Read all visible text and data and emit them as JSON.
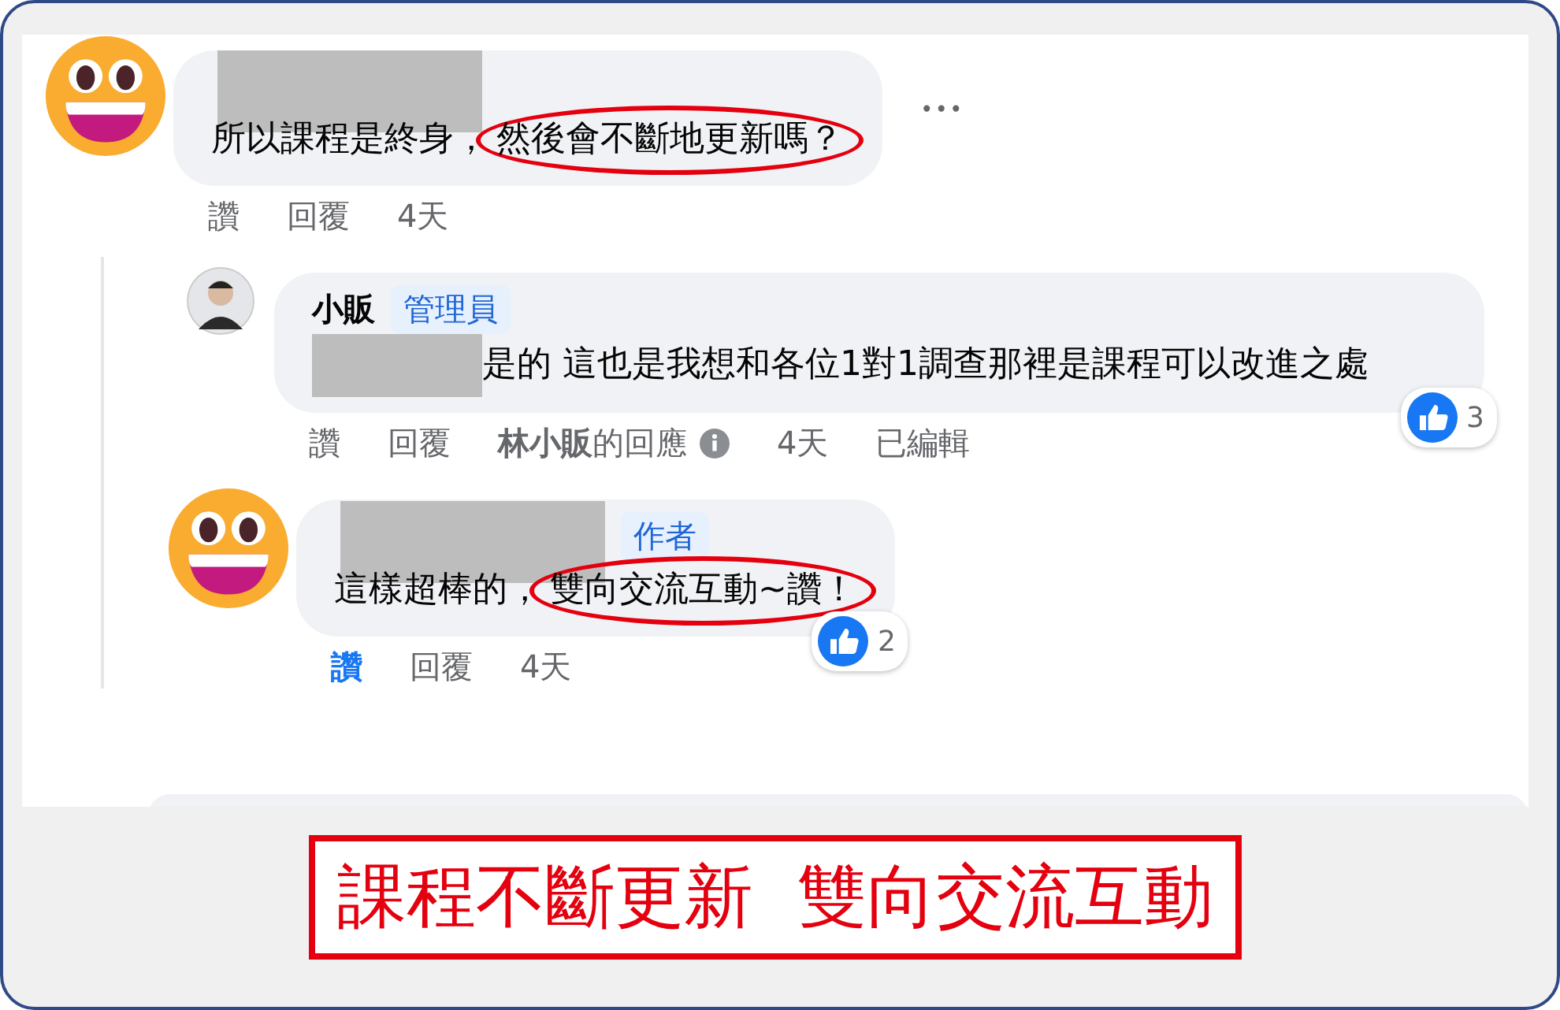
{
  "comments": [
    {
      "avatar": {
        "kind": "emoji"
      },
      "author": {
        "redacted": true
      },
      "text": "所以課程是終身，",
      "circled": "然後會不斷地更新嗎？",
      "more": "•••",
      "actions": {
        "like": "讚",
        "liked": false,
        "reply": "回覆",
        "time": "4天"
      },
      "children": [
        {
          "avatar": {
            "kind": "photo"
          },
          "author": {
            "name": "小販",
            "badge": "管理員"
          },
          "text": "是的 這也是我想和各位1對1調查那裡是課程可以改進之處",
          "text_redacted_prefix": true,
          "reaction": {
            "count": "3"
          },
          "actions": {
            "like": "讚",
            "liked": false,
            "reply": "回覆",
            "responder": "**林小販**的回應",
            "time": "4天",
            "edited": "已編輯"
          }
        },
        {
          "avatar": {
            "kind": "emoji"
          },
          "author": {
            "redacted": true,
            "badge": "作者"
          },
          "text": "這樣超棒的，",
          "circled": "雙向交流互動~讚！",
          "reaction": {
            "count": "2"
          },
          "actions": {
            "like": "讚",
            "liked": true,
            "reply": "回覆",
            "time": "4天"
          }
        }
      ]
    }
  ],
  "caption": "課程不斷更新  雙向交流互動"
}
